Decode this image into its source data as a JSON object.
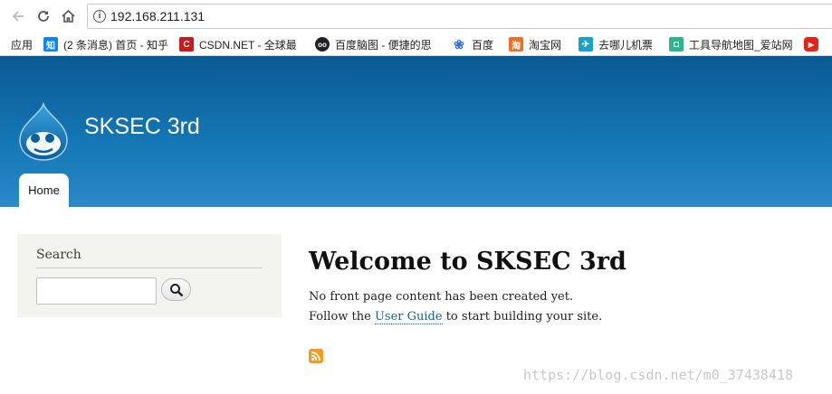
{
  "browser": {
    "url": "192.168.211.131",
    "bookmarks": [
      {
        "label": "应用",
        "icon": "apps-icon",
        "color": "#4285f4"
      },
      {
        "label": "(2 条消息) 首页 - 知乎",
        "icon": "zhihu-icon",
        "color": "#0a84ff",
        "glyph": "知"
      },
      {
        "label": "CSDN.NET - 全球最",
        "icon": "csdn-icon",
        "color": "#c9191a",
        "glyph": "C"
      },
      {
        "label": "百度脑图 - 便捷的思",
        "icon": "baidu-mind-icon",
        "color": "#222222",
        "glyph": "oo"
      },
      {
        "label": "百度",
        "icon": "baidu-paw-icon",
        "color": "#2f6fe6",
        "glyph": "❀"
      },
      {
        "label": "淘宝网",
        "icon": "taobao-icon",
        "color": "#f27022",
        "glyph": "淘"
      },
      {
        "label": "去哪儿机票",
        "icon": "qunar-icon",
        "color": "#19a2c8",
        "glyph": "✈"
      },
      {
        "label": "工具导航地图_爱站网",
        "icon": "tool-nav-icon",
        "color": "#2bb48e",
        "glyph": "◘"
      },
      {
        "label": "",
        "icon": "youtube-icon",
        "color": "#e62117",
        "glyph": "▶"
      }
    ]
  },
  "site": {
    "name": "SKSEC 3rd",
    "nav": {
      "home_label": "Home"
    }
  },
  "sidebar": {
    "search_title": "Search",
    "search_value": ""
  },
  "main": {
    "title": "Welcome to SKSEC 3rd",
    "line1": "No front page content has been created yet.",
    "line2_prefix": "Follow the ",
    "line2_link": "User Guide",
    "line2_suffix": " to start building your site."
  },
  "watermark": "https://blog.csdn.net/m0_37438418"
}
